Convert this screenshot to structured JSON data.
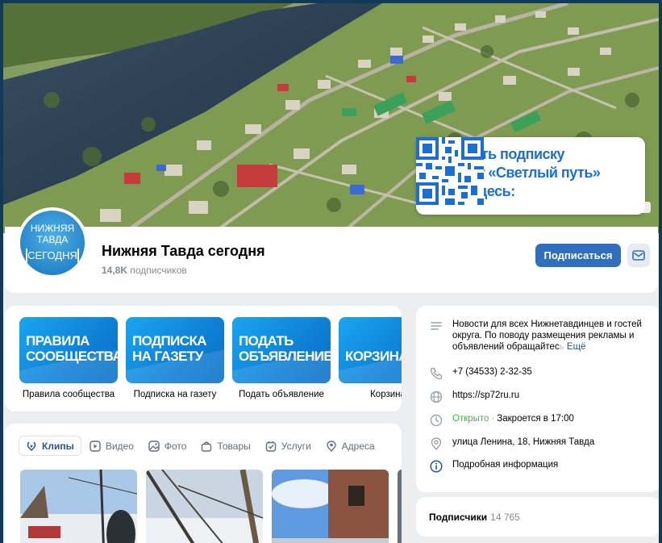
{
  "cover": {
    "promo_lines": [
      "Оформить подписку",
      "на газету «Светлый путь»",
      "можно здесь:"
    ]
  },
  "avatar": {
    "line1": "НИЖНЯЯ",
    "line2": "ТАВДА",
    "line3": "СЕГОДНЯ"
  },
  "header": {
    "title": "Нижняя Тавда сегодня",
    "subscribers_count": "14,8K",
    "subscribers_label": "подписчиков",
    "subscribe_label": "Подписаться"
  },
  "links": [
    {
      "thumb_text": "ПРАВИЛА\nСООБЩЕСТВА",
      "label": "Правила сообщества"
    },
    {
      "thumb_text": "ПОДПИСКА\nНА ГАЗЕТУ",
      "label": "Подписка на газету"
    },
    {
      "thumb_text": "ПОДАТЬ\nОБЪЯВЛЕНИЕ",
      "label": "Подать объявление"
    },
    {
      "thumb_text": "\nКОРЗИНА",
      "label": "Корзина"
    }
  ],
  "tabs": [
    {
      "label": "Клипы",
      "icon": "clips-icon",
      "active": true
    },
    {
      "label": "Видео",
      "icon": "video-icon",
      "active": false
    },
    {
      "label": "Фото",
      "icon": "photo-icon",
      "active": false
    },
    {
      "label": "Товары",
      "icon": "shopping-bag-icon",
      "active": false
    },
    {
      "label": "Услуги",
      "icon": "services-icon",
      "active": false
    },
    {
      "label": "Адреса",
      "icon": "location-icon",
      "active": false
    }
  ],
  "info": {
    "description": "Новости для всех Нижнетавдинцев и гостей округа. По поводу размещения рекламы и объявлений обращайтес",
    "description_fade": "ь",
    "more": "Ещё",
    "phone": "+7 (34533) 2-32-35",
    "website": "https://sp72ru.ru",
    "open_status": "Открыто",
    "closes": "Закроется в 17:00",
    "address": "улица Ленина, 18, Нижняя Тавда",
    "details": "Подробная информация"
  },
  "subscribers": {
    "title": "Подписчики",
    "count": "14 765"
  },
  "colors": {
    "accent": "#2f6fbe",
    "link": "#2a5885",
    "open_green": "#4bb34b",
    "page_bg": "#edeef0",
    "outer_bg": "#0f3a58"
  }
}
